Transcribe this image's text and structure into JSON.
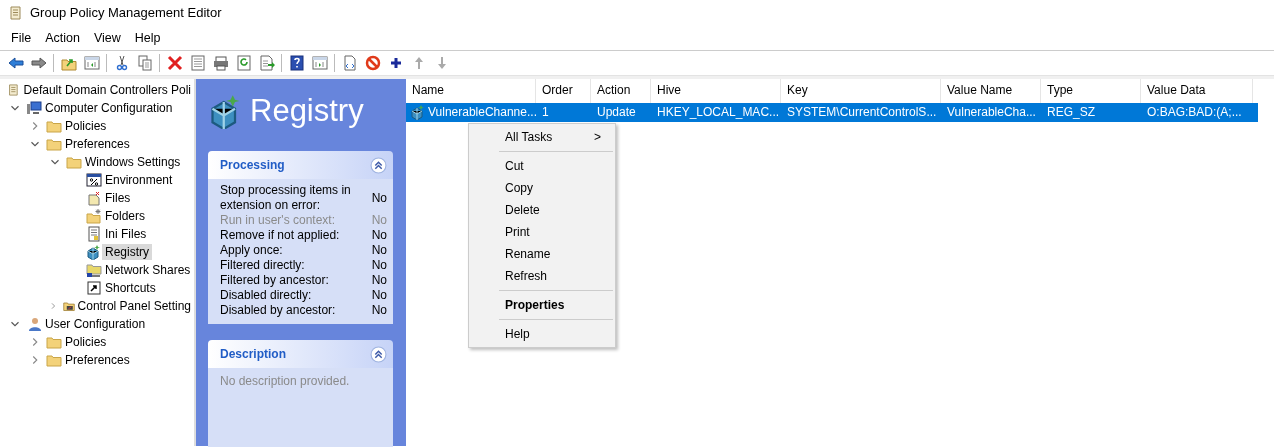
{
  "window": {
    "title": "Group Policy Management Editor"
  },
  "menu_bar": [
    "File",
    "Action",
    "View",
    "Help"
  ],
  "tree": [
    {
      "label": "Default Domain Controllers Poli",
      "kind": "gpo",
      "selected": false,
      "children": [
        {
          "label": "Computer Configuration",
          "kind": "computer",
          "selected": false,
          "expanded": true,
          "children": [
            {
              "label": "Policies",
              "kind": "folder",
              "selected": false,
              "expanded": false
            },
            {
              "label": "Preferences",
              "kind": "folder",
              "selected": false,
              "expanded": true,
              "children": [
                {
                  "label": "Windows Settings",
                  "kind": "folder",
                  "selected": false,
                  "expanded": true,
                  "children": [
                    {
                      "label": "Environment",
                      "kind": "environment",
                      "selected": false
                    },
                    {
                      "label": "Files",
                      "kind": "files",
                      "selected": false
                    },
                    {
                      "label": "Folders",
                      "kind": "folders",
                      "selected": false
                    },
                    {
                      "label": "Ini Files",
                      "kind": "ini",
                      "selected": false
                    },
                    {
                      "label": "Registry",
                      "kind": "registry",
                      "selected": true
                    },
                    {
                      "label": "Network Shares",
                      "kind": "shares",
                      "selected": false
                    },
                    {
                      "label": "Shortcuts",
                      "kind": "shortcut",
                      "selected": false
                    }
                  ]
                },
                {
                  "label": "Control Panel Setting",
                  "kind": "controlpanel",
                  "selected": false,
                  "expanded": false
                }
              ]
            }
          ]
        },
        {
          "label": "User Configuration",
          "kind": "user",
          "selected": false,
          "expanded": true,
          "children": [
            {
              "label": "Policies",
              "kind": "folder",
              "selected": false,
              "expanded": false
            },
            {
              "label": "Preferences",
              "kind": "folder",
              "selected": false,
              "expanded": false
            }
          ]
        }
      ]
    }
  ],
  "header": {
    "title": "Registry"
  },
  "processing": {
    "title": "Processing",
    "rows": [
      {
        "label": "Stop processing items in extension on error:",
        "value": "No",
        "disabled": false
      },
      {
        "label": "Run in user's context:",
        "value": "No",
        "disabled": true
      },
      {
        "label": "Remove if not applied:",
        "value": "No",
        "disabled": false
      },
      {
        "label": "Apply once:",
        "value": "No",
        "disabled": false
      },
      {
        "label": "Filtered directly:",
        "value": "No",
        "disabled": false
      },
      {
        "label": "Filtered by ancestor:",
        "value": "No",
        "disabled": false
      },
      {
        "label": "Disabled directly:",
        "value": "No",
        "disabled": false
      },
      {
        "label": "Disabled by ancestor:",
        "value": "No",
        "disabled": false
      }
    ]
  },
  "description": {
    "title": "Description",
    "text": "No description provided."
  },
  "table": {
    "columns": [
      "Name",
      "Order",
      "Action",
      "Hive",
      "Key",
      "Value Name",
      "Type",
      "Value Data"
    ],
    "rows": [
      {
        "selected": true,
        "cells": [
          "VulnerableChanne...",
          "1",
          "Update",
          "HKEY_LOCAL_MAC...",
          "SYSTEM\\CurrentControlS...",
          "VulnerableCha...",
          "REG_SZ",
          "O:BAG:BAD:(A;..."
        ]
      }
    ]
  },
  "context_menu": {
    "groups": [
      [
        {
          "label": "All Tasks",
          "default": false,
          "submenu_arrow": ">"
        }
      ],
      [
        {
          "label": "Cut",
          "default": false
        },
        {
          "label": "Copy",
          "default": false
        },
        {
          "label": "Delete",
          "default": false
        },
        {
          "label": "Print",
          "default": false
        },
        {
          "label": "Rename",
          "default": false
        },
        {
          "label": "Refresh",
          "default": false
        }
      ],
      [
        {
          "label": "Properties",
          "default": true
        }
      ],
      [
        {
          "label": "Help",
          "default": false
        }
      ]
    ]
  }
}
